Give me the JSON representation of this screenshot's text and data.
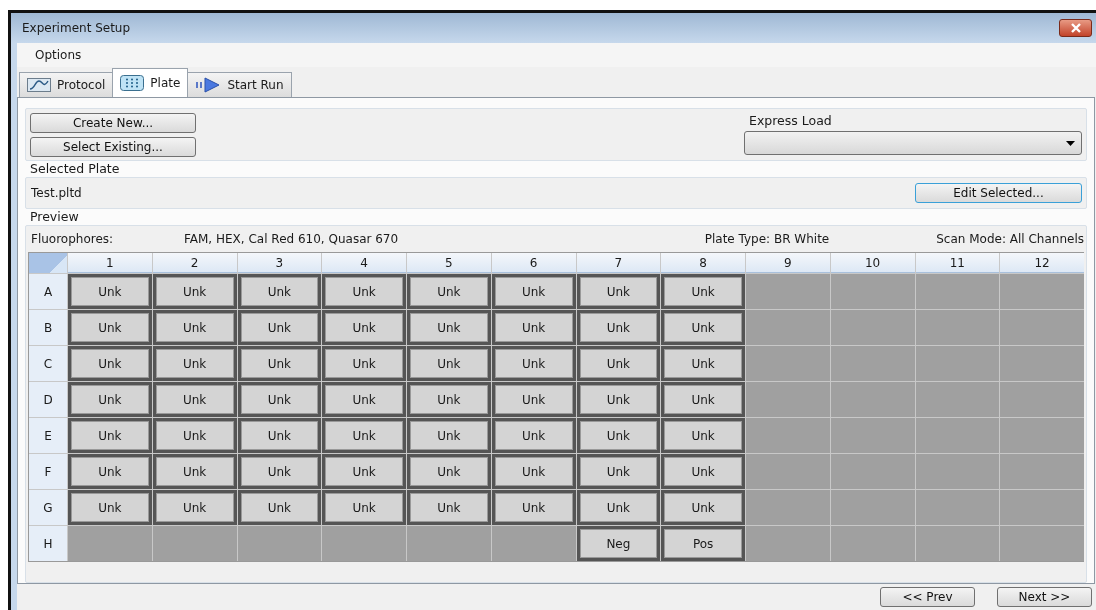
{
  "window": {
    "title": "Experiment Setup"
  },
  "menu": [
    "Options"
  ],
  "tabs": [
    {
      "label": "Protocol",
      "selected": false
    },
    {
      "label": "Plate",
      "selected": true
    },
    {
      "label": "Start Run",
      "selected": false
    }
  ],
  "buttons": {
    "create": "Create New...",
    "select": "Select Existing...",
    "edit": "Edit Selected..."
  },
  "express_load": {
    "label": "Express Load"
  },
  "selected_plate": {
    "label": "Selected Plate",
    "file": "Test.pltd"
  },
  "preview": {
    "label": "Preview",
    "fluorophores_label": "Fluorophores:",
    "fluorophores": "FAM, HEX, Cal Red 610, Quasar 670",
    "plate_type": "Plate Type: BR White",
    "scan_mode": "Scan Mode: All Channels"
  },
  "plate": {
    "columns": [
      "1",
      "2",
      "3",
      "4",
      "5",
      "6",
      "7",
      "8",
      "9",
      "10",
      "11",
      "12"
    ],
    "rows": [
      {
        "label": "A",
        "wells": [
          {
            "filled": true,
            "content": "Unk"
          },
          {
            "filled": true,
            "content": "Unk"
          },
          {
            "filled": true,
            "content": "Unk"
          },
          {
            "filled": true,
            "content": "Unk"
          },
          {
            "filled": true,
            "content": "Unk"
          },
          {
            "filled": true,
            "content": "Unk"
          },
          {
            "filled": true,
            "content": "Unk"
          },
          {
            "filled": true,
            "content": "Unk"
          },
          {
            "filled": false
          },
          {
            "filled": false
          },
          {
            "filled": false
          },
          {
            "filled": false
          }
        ]
      },
      {
        "label": "B",
        "wells": [
          {
            "filled": true,
            "content": "Unk"
          },
          {
            "filled": true,
            "content": "Unk"
          },
          {
            "filled": true,
            "content": "Unk"
          },
          {
            "filled": true,
            "content": "Unk"
          },
          {
            "filled": true,
            "content": "Unk"
          },
          {
            "filled": true,
            "content": "Unk"
          },
          {
            "filled": true,
            "content": "Unk"
          },
          {
            "filled": true,
            "content": "Unk"
          },
          {
            "filled": false
          },
          {
            "filled": false
          },
          {
            "filled": false
          },
          {
            "filled": false
          }
        ]
      },
      {
        "label": "C",
        "wells": [
          {
            "filled": true,
            "content": "Unk"
          },
          {
            "filled": true,
            "content": "Unk"
          },
          {
            "filled": true,
            "content": "Unk"
          },
          {
            "filled": true,
            "content": "Unk"
          },
          {
            "filled": true,
            "content": "Unk"
          },
          {
            "filled": true,
            "content": "Unk"
          },
          {
            "filled": true,
            "content": "Unk"
          },
          {
            "filled": true,
            "content": "Unk"
          },
          {
            "filled": false
          },
          {
            "filled": false
          },
          {
            "filled": false
          },
          {
            "filled": false
          }
        ]
      },
      {
        "label": "D",
        "wells": [
          {
            "filled": true,
            "content": "Unk"
          },
          {
            "filled": true,
            "content": "Unk"
          },
          {
            "filled": true,
            "content": "Unk"
          },
          {
            "filled": true,
            "content": "Unk"
          },
          {
            "filled": true,
            "content": "Unk"
          },
          {
            "filled": true,
            "content": "Unk"
          },
          {
            "filled": true,
            "content": "Unk"
          },
          {
            "filled": true,
            "content": "Unk"
          },
          {
            "filled": false
          },
          {
            "filled": false
          },
          {
            "filled": false
          },
          {
            "filled": false
          }
        ]
      },
      {
        "label": "E",
        "wells": [
          {
            "filled": true,
            "content": "Unk"
          },
          {
            "filled": true,
            "content": "Unk"
          },
          {
            "filled": true,
            "content": "Unk"
          },
          {
            "filled": true,
            "content": "Unk"
          },
          {
            "filled": true,
            "content": "Unk"
          },
          {
            "filled": true,
            "content": "Unk"
          },
          {
            "filled": true,
            "content": "Unk"
          },
          {
            "filled": true,
            "content": "Unk"
          },
          {
            "filled": false
          },
          {
            "filled": false
          },
          {
            "filled": false
          },
          {
            "filled": false
          }
        ]
      },
      {
        "label": "F",
        "wells": [
          {
            "filled": true,
            "content": "Unk"
          },
          {
            "filled": true,
            "content": "Unk"
          },
          {
            "filled": true,
            "content": "Unk"
          },
          {
            "filled": true,
            "content": "Unk"
          },
          {
            "filled": true,
            "content": "Unk"
          },
          {
            "filled": true,
            "content": "Unk"
          },
          {
            "filled": true,
            "content": "Unk"
          },
          {
            "filled": true,
            "content": "Unk"
          },
          {
            "filled": false
          },
          {
            "filled": false
          },
          {
            "filled": false
          },
          {
            "filled": false
          }
        ]
      },
      {
        "label": "G",
        "wells": [
          {
            "filled": true,
            "content": "Unk"
          },
          {
            "filled": true,
            "content": "Unk"
          },
          {
            "filled": true,
            "content": "Unk"
          },
          {
            "filled": true,
            "content": "Unk"
          },
          {
            "filled": true,
            "content": "Unk"
          },
          {
            "filled": true,
            "content": "Unk"
          },
          {
            "filled": true,
            "content": "Unk"
          },
          {
            "filled": true,
            "content": "Unk"
          },
          {
            "filled": false
          },
          {
            "filled": false
          },
          {
            "filled": false
          },
          {
            "filled": false
          }
        ]
      },
      {
        "label": "H",
        "wells": [
          {
            "filled": false
          },
          {
            "filled": false
          },
          {
            "filled": false
          },
          {
            "filled": false
          },
          {
            "filled": false
          },
          {
            "filled": false
          },
          {
            "filled": true,
            "content": "Neg"
          },
          {
            "filled": true,
            "content": "Pos"
          },
          {
            "filled": false
          },
          {
            "filled": false
          },
          {
            "filled": false
          },
          {
            "filled": false
          }
        ]
      }
    ]
  },
  "nav": {
    "prev": "<< Prev",
    "next": "Next >>"
  }
}
